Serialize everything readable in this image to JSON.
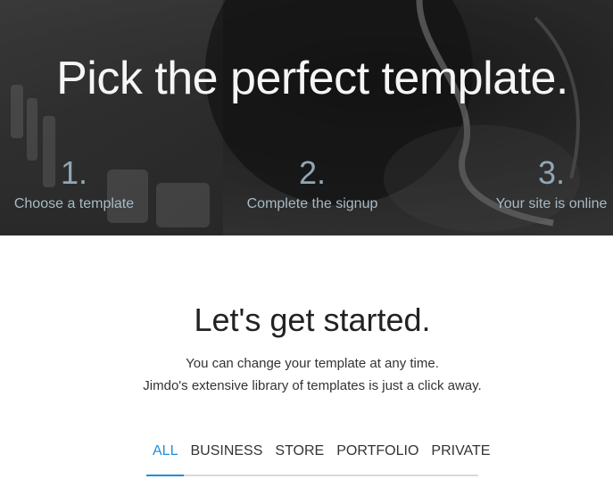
{
  "hero": {
    "title": "Pick the perfect template.",
    "steps": [
      {
        "number": "1.",
        "label": "Choose a template"
      },
      {
        "number": "2.",
        "label": "Complete the signup"
      },
      {
        "number": "3.",
        "label": "Your site is online"
      }
    ]
  },
  "intro": {
    "title": "Let's get started.",
    "line1": "You can change your template at any time.",
    "line2": "Jimdo's extensive library of templates is just a click away."
  },
  "tabs": [
    {
      "label": "ALL",
      "active": true
    },
    {
      "label": "BUSINESS",
      "active": false
    },
    {
      "label": "STORE",
      "active": false
    },
    {
      "label": "PORTFOLIO",
      "active": false
    },
    {
      "label": "PRIVATE",
      "active": false
    }
  ],
  "colors": {
    "hero_bg": "#2e2e2e",
    "step_text": "#8fa7b6",
    "tab_active": "#1f8fd8",
    "tab_text": "#333333"
  }
}
